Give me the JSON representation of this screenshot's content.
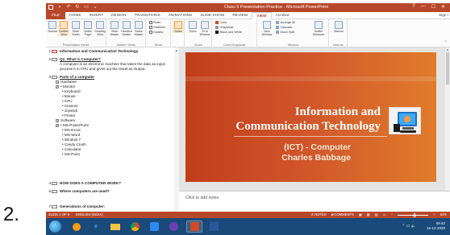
{
  "page_number": "2.",
  "window": {
    "title": "Class 5 Presentation Practice - Microsoft PowerPoint",
    "help": "?",
    "controls": [
      "—",
      "☐",
      "✕"
    ],
    "sign_in": "Sign i"
  },
  "tabs": [
    {
      "label": "FILE"
    },
    {
      "label": "HOME"
    },
    {
      "label": "INSERT"
    },
    {
      "label": "DESIGN"
    },
    {
      "label": "TRANSITIONS"
    },
    {
      "label": "ANIMATIONS"
    },
    {
      "label": "SLIDE SHOW"
    },
    {
      "label": "REVIEW"
    },
    {
      "label": "VIEW"
    },
    {
      "label": "Acrobat"
    }
  ],
  "active_tab": "VIEW",
  "ribbon": {
    "presentation_views": {
      "label": "Presentation Views",
      "buttons": [
        {
          "label": "Normal"
        },
        {
          "label": "Outline View",
          "selected": true
        },
        {
          "label": "Slide Sorter"
        },
        {
          "label": "Notes Page"
        },
        {
          "label": "Reading View"
        }
      ]
    },
    "master_views": {
      "label": "Master Views",
      "buttons": [
        {
          "label": "Slide Master"
        },
        {
          "label": "Handout Master"
        },
        {
          "label": "Notes Master"
        }
      ]
    },
    "show": {
      "label": "Show",
      "items": [
        "Ruler",
        "Gridlines",
        "Guides"
      ]
    },
    "notes_btn": {
      "label": "Notes"
    },
    "zoom": {
      "label": "Zoom",
      "buttons": [
        {
          "label": "Zoom"
        },
        {
          "label": "Fit to Window"
        }
      ]
    },
    "color": {
      "label": "Color/Grayscale",
      "items": [
        "Color",
        "Grayscale",
        "Black and White"
      ]
    },
    "window": {
      "label": "Window",
      "new_window": "New Window",
      "items": [
        "Arrange All",
        "Cascade",
        "Move Split"
      ],
      "switch": "Switch Windows"
    },
    "macros": {
      "label": "Macros",
      "button": "Macros"
    }
  },
  "outline": {
    "slides": [
      {
        "num": "1",
        "title": "Information and Communication Technology",
        "current": true
      },
      {
        "num": "2",
        "title": "Q1. What is Computer?",
        "body": [
          "A computer is an electronic machine that takes the data as input,",
          "process it in CPU and gives out the result as Output."
        ]
      },
      {
        "num": "3",
        "title": "Parts of a computer",
        "underline": true,
        "level1": [
          {
            "n": "1",
            "text": "Hardware"
          },
          {
            "n": "2",
            "text": "• Monitor"
          }
        ],
        "bullets_a": [
          "• Keyboard",
          "• Mouse",
          "• CPU",
          "• Scanner",
          "• Joystick",
          "• Printer"
        ],
        "level1_b": [
          {
            "n": "3",
            "text": "Software"
          },
          {
            "n": "4",
            "text": "• MS-PowerPoint"
          }
        ],
        "bullets_b": [
          "• MS-Excel",
          "• MS-Word",
          "• Window 7",
          "• Candy Crush",
          "• Calculator",
          "• MS-Paint"
        ]
      },
      {
        "num": "4",
        "title": "HOW DOES A COMPUTER WORK?"
      },
      {
        "num": "5",
        "title": "Where computers are used?"
      },
      {
        "num": "7",
        "title": "Generations of computer:"
      }
    ]
  },
  "slide": {
    "title_line1": "Information and",
    "title_line2": "Communication Technology",
    "subtitle_line1": "(ICT) - Computer",
    "subtitle_line2": "Charles Babbage"
  },
  "notes_placeholder": "Click to add notes",
  "status": {
    "slide_info": "SLIDE 1 OF 9",
    "language": "ENGLISH (INDIA)",
    "notes": "≜ NOTES",
    "comments": "■ COMMENTS",
    "zoom": "64%"
  },
  "taskbar": {
    "time": "09:42",
    "date": "15-12-2020"
  },
  "colors": {
    "accent": "#b7472a",
    "taskbar": "#1a4a7a",
    "slide_bg": "#c8461e"
  }
}
